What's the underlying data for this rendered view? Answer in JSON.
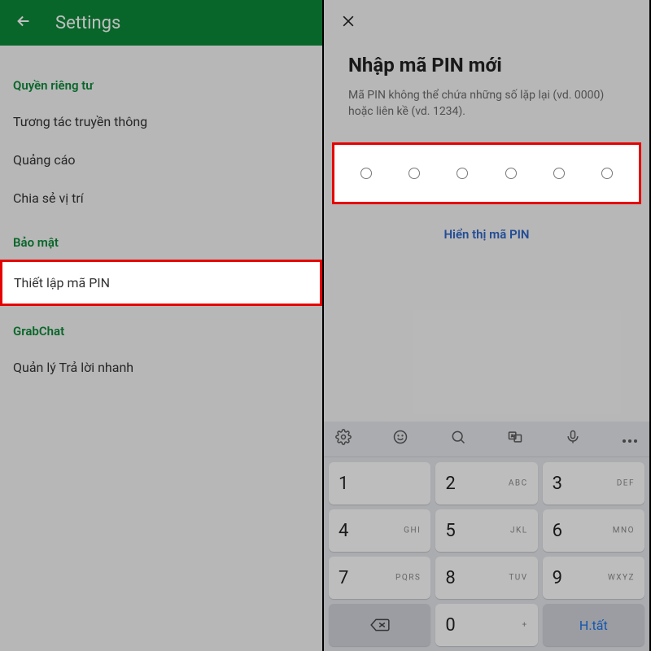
{
  "left": {
    "title": "Settings",
    "sections": [
      {
        "header": "Quyền riêng tư",
        "items": [
          "Tương tác truyền thông",
          "Quảng cáo",
          "Chia sẻ vị trí"
        ]
      },
      {
        "header": "Bảo mật",
        "items": [
          "Thiết lập mã PIN"
        ],
        "highlighted_index": 0
      },
      {
        "header": "GrabChat",
        "items": [
          "Quản lý Trả lời nhanh"
        ]
      }
    ]
  },
  "right": {
    "title": "Nhập mã PIN mới",
    "hint": "Mã PIN không thể chứa những số lặp lại (vd. 0000) hoặc liên kề (vd. 1234).",
    "show_pin_label": "Hiển thị mã PIN",
    "pin_length": 6
  },
  "keypad": {
    "keys": [
      {
        "num": "1",
        "letters": ""
      },
      {
        "num": "2",
        "letters": "ABC"
      },
      {
        "num": "3",
        "letters": "DEF"
      },
      {
        "num": "4",
        "letters": "GHI"
      },
      {
        "num": "5",
        "letters": "JKL"
      },
      {
        "num": "6",
        "letters": "MNO"
      },
      {
        "num": "7",
        "letters": "PQRS"
      },
      {
        "num": "8",
        "letters": "TUV"
      },
      {
        "num": "9",
        "letters": "WXYZ"
      },
      {
        "num": "0",
        "letters": "+"
      }
    ],
    "done_label": "H.tất"
  }
}
